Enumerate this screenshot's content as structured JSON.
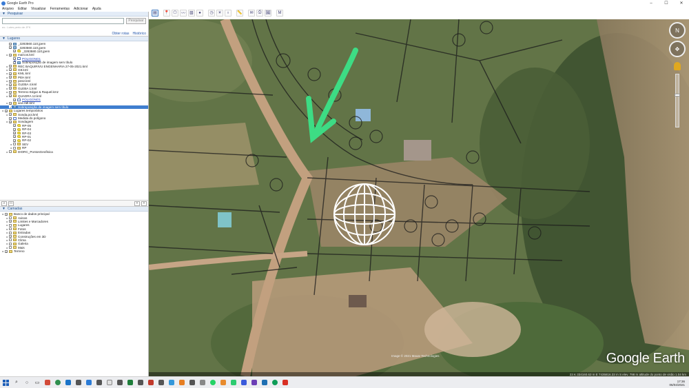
{
  "window": {
    "title": "Google Earth Pro"
  },
  "menu": [
    "Arquivo",
    "Editar",
    "Visualizar",
    "Ferramentas",
    "Adicionar",
    "Ajuda"
  ],
  "search": {
    "header": "Pesquisar",
    "button": "Pesquisar",
    "hint": "ex.: Lotes perto de JFK",
    "links": [
      "Obter rotas",
      "Histórico"
    ]
  },
  "places": {
    "header": "Lugares",
    "items": [
      {
        "label": "_3283560.110.jpem",
        "kind": "img",
        "level": 1,
        "checked": true
      },
      {
        "label": "_3283560.110.jpem",
        "kind": "img",
        "level": 1,
        "checked": true
      },
      {
        "label": "_3283580.110.jpem",
        "kind": "pin",
        "level": 2,
        "checked": true
      },
      {
        "label": "marcos.kml",
        "kind": "folder",
        "level": 1,
        "checked": true
      },
      {
        "label": "POLIGONO1",
        "kind": "poly",
        "level": 2,
        "checked": true,
        "style": "link"
      },
      {
        "label": "Sobreposição de imagem sem título",
        "kind": "img",
        "level": 2,
        "checked": true
      },
      {
        "label": "REC BAQUIRIVU ENGENHARIA 27-05-2021.kml",
        "kind": "folder",
        "level": 1,
        "checked": true
      },
      {
        "label": "G8.kml",
        "kind": "folder",
        "level": 1,
        "checked": true
      },
      {
        "label": "KML.kml",
        "kind": "folder",
        "level": 1,
        "checked": true
      },
      {
        "label": "PEH.kml",
        "kind": "folder",
        "level": 1,
        "checked": true
      },
      {
        "label": "pes2.kml",
        "kind": "folder",
        "level": 1,
        "checked": true
      },
      {
        "label": "GLEBA 4.kml",
        "kind": "folder",
        "level": 1,
        "checked": true
      },
      {
        "label": "GLEBA 1.kml",
        "kind": "folder",
        "level": 1,
        "checked": true
      },
      {
        "label": "Terreno Edgar & Raquel.kmz",
        "kind": "folder",
        "level": 1,
        "checked": true
      },
      {
        "label": "QUADRA 12.kml",
        "kind": "folder",
        "level": 1,
        "checked": true
      },
      {
        "label": "POLIGONO1",
        "kind": "poly",
        "level": 2,
        "checked": true,
        "style": "link"
      },
      {
        "label": "ana rafi.kml",
        "kind": "folder",
        "level": 1,
        "checked": true
      },
      {
        "label": "Sobreposição de imagem sem título",
        "kind": "img",
        "level": 1,
        "checked": true,
        "selected": true
      },
      {
        "label": "Lugares temporários",
        "kind": "folder",
        "level": 0,
        "checked": true
      },
      {
        "label": "Sonda.poi.kml",
        "kind": "folder",
        "level": 1,
        "checked": true
      },
      {
        "label": "Medida do polígono",
        "kind": "poly",
        "level": 1,
        "checked": true
      },
      {
        "label": "Sondagem",
        "kind": "folder",
        "level": 1,
        "checked": true
      },
      {
        "label": "RP-05",
        "kind": "pin",
        "level": 2,
        "checked": true
      },
      {
        "label": "RP-04",
        "kind": "pin",
        "level": 2,
        "checked": true
      },
      {
        "label": "RP-03",
        "kind": "pin",
        "level": 2,
        "checked": true
      },
      {
        "label": "RP-01",
        "kind": "pin",
        "level": 2,
        "checked": true
      },
      {
        "label": "RP-02",
        "kind": "pin",
        "level": 2,
        "checked": true
      },
      {
        "label": "SEV",
        "kind": "folder",
        "level": 2,
        "checked": false
      },
      {
        "label": "RP",
        "kind": "folder",
        "level": 2,
        "checked": false
      },
      {
        "label": "DIORC_PontosGeofisica",
        "kind": "folder",
        "level": 1,
        "checked": false
      }
    ]
  },
  "layers": {
    "header": "Camadas",
    "items": [
      {
        "label": "Banco de dados principal",
        "kind": "folder",
        "level": 0,
        "checked": true
      },
      {
        "label": "Avisos",
        "kind": "folder",
        "level": 1,
        "checked": false
      },
      {
        "label": "Limites e Marcadores",
        "kind": "folder",
        "level": 1,
        "checked": true
      },
      {
        "label": "Lugares",
        "kind": "folder",
        "level": 1,
        "checked": false
      },
      {
        "label": "Fotos",
        "kind": "folder",
        "level": 1,
        "checked": false
      },
      {
        "label": "Estradas",
        "kind": "folder",
        "level": 1,
        "checked": false
      },
      {
        "label": "Construções em 3D",
        "kind": "folder",
        "level": 1,
        "checked": true
      },
      {
        "label": "Clima",
        "kind": "folder",
        "level": 1,
        "checked": false
      },
      {
        "label": "Galeria",
        "kind": "folder",
        "level": 1,
        "checked": false
      },
      {
        "label": "Mais",
        "kind": "folder",
        "level": 1,
        "checked": false
      },
      {
        "label": "Terreno",
        "kind": "folder",
        "level": 0,
        "checked": true
      }
    ]
  },
  "map": {
    "brand": "Google Earth",
    "credit": "Image © 2021 Maxar Technologies",
    "status": "23 K 334160.63 m E 7435816.33 m S   elev. 798 m      altitude do ponto de visão 1.04 km"
  },
  "tray": {
    "time": "17:36",
    "date": "06/04/2021"
  },
  "colors": {
    "accent": "#3f7ecf",
    "arrow": "#3ddc84"
  }
}
